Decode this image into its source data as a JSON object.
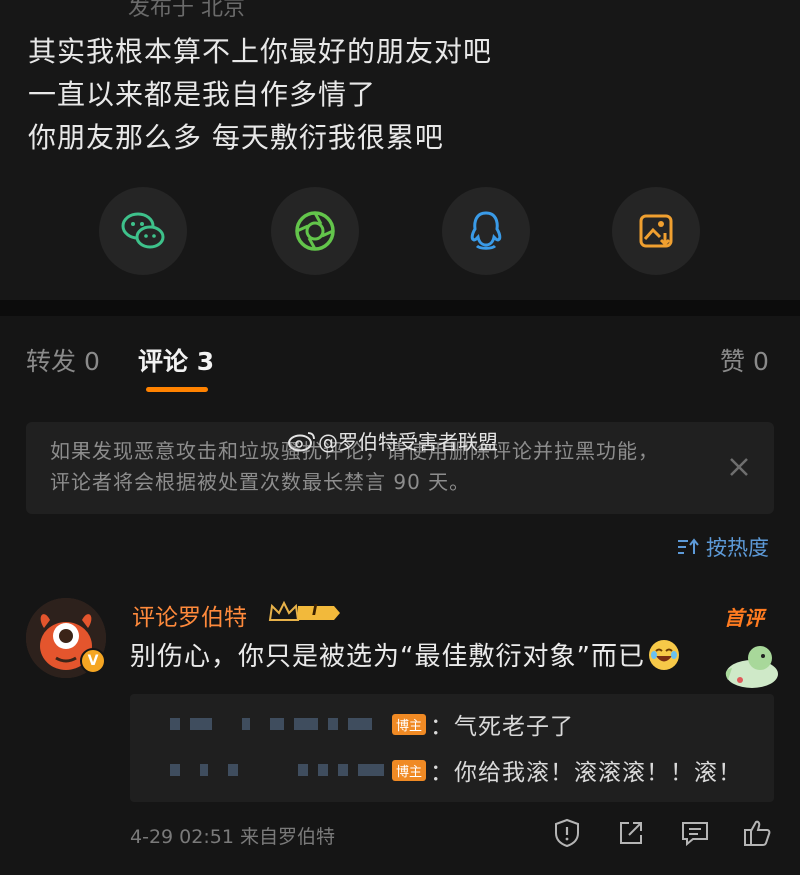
{
  "post": {
    "meta_partial": "发布于 北京",
    "lines": [
      "其实我根本算不上你最好的朋友对吧",
      "一直以来都是我自作多情了",
      "你朋友那么多 每天敷衍我很累吧"
    ]
  },
  "share": [
    {
      "name": "wechat-icon",
      "color": "#3ec28b"
    },
    {
      "name": "moments-icon",
      "color": "#63c54b"
    },
    {
      "name": "qq-icon",
      "color": "#3a9be8"
    },
    {
      "name": "save-image-icon",
      "color": "#f0a030"
    }
  ],
  "tabs": {
    "repost": "转发 0",
    "comments": "评论 3",
    "likes": "赞 0"
  },
  "notice": {
    "line1": "如果发现恶意攻击和垃圾骚扰评论，请使用删除评论并拉黑功能，",
    "line2": "评论者将会根据被处置次数最长禁言 90 天。"
  },
  "watermark": "@罗伯特受害者联盟",
  "sort_label": "按热度",
  "comment": {
    "author": "评论罗伯特",
    "rank_badge": "I",
    "first_tag": "首评",
    "text": "别伤心，你只是被选为“最佳敷衍对象”而已",
    "replies": [
      {
        "owner_tag": "博主",
        "text": "：气死老子了"
      },
      {
        "owner_tag": "博主",
        "text": "：你给我滚！滚滚滚！！滚！"
      }
    ],
    "footer": "4-29 02:51 来自罗伯特"
  },
  "colors": {
    "accent": "#ff8200",
    "link": "#5d9ad8",
    "author": "#ff8a3c"
  }
}
